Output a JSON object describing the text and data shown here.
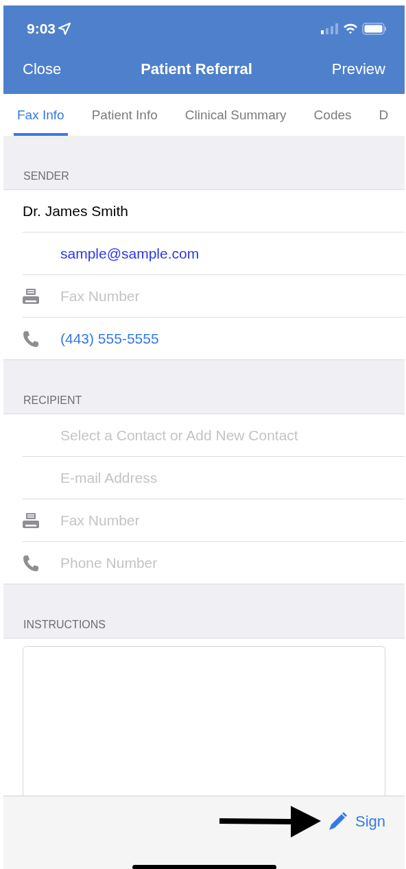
{
  "status_bar": {
    "time": "9:03"
  },
  "nav": {
    "left": "Close",
    "title": "Patient Referral",
    "right": "Preview"
  },
  "tabs": [
    {
      "label": "Fax Info",
      "selected": true
    },
    {
      "label": "Patient Info",
      "selected": false
    },
    {
      "label": "Clinical Summary",
      "selected": false
    },
    {
      "label": "Codes",
      "selected": false
    },
    {
      "label": "D",
      "selected": false
    }
  ],
  "sections": [
    {
      "header": "SENDER",
      "rows": [
        {
          "kind": "name",
          "value": "Dr. James Smith"
        },
        {
          "kind": "email",
          "value": "sample@sample.com"
        },
        {
          "kind": "fax",
          "placeholder": "Fax Number"
        },
        {
          "kind": "phone",
          "value": "(443) 555-5555"
        }
      ]
    },
    {
      "header": "RECIPIENT",
      "rows": [
        {
          "kind": "contact",
          "placeholder": "Select a Contact or Add New Contact"
        },
        {
          "kind": "email",
          "placeholder": "E-mail Address"
        },
        {
          "kind": "fax",
          "placeholder": "Fax Number"
        },
        {
          "kind": "phone",
          "placeholder": "Phone Number"
        }
      ]
    },
    {
      "header": "INSTRUCTIONS",
      "rows": [
        {
          "kind": "textarea"
        }
      ]
    }
  ],
  "footer": {
    "button": "Sign"
  }
}
